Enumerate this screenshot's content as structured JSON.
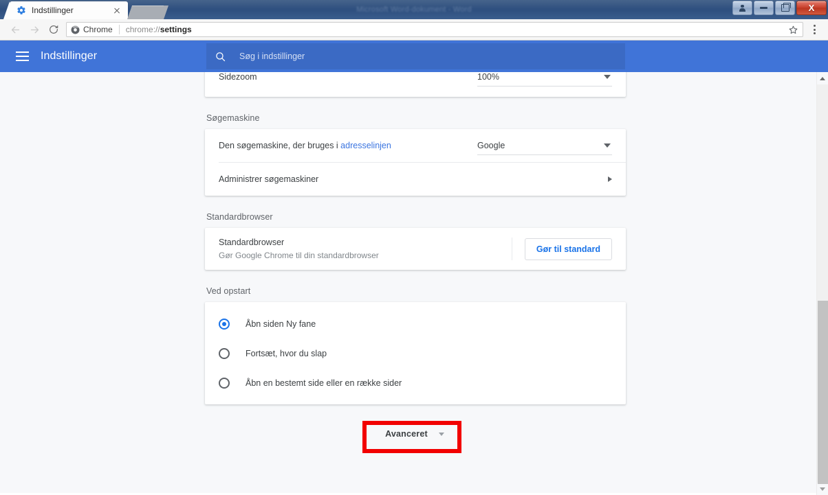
{
  "window": {
    "background_title": "Microsoft Word-dokument - Word",
    "caption_buttons": [
      {
        "name": "account-button",
        "icon": "user-icon",
        "label": ""
      },
      {
        "name": "minimize-button",
        "icon": "minimize-icon",
        "label": ""
      },
      {
        "name": "restore-button",
        "icon": "restore-icon",
        "label": ""
      },
      {
        "name": "close-button",
        "icon": "close-icon",
        "label": "X"
      }
    ]
  },
  "tabs": [
    {
      "title": "Indstillinger",
      "favicon": "gear-icon",
      "active": true
    }
  ],
  "toolbar": {
    "back_icon": "arrow-left-icon",
    "forward_icon": "arrow-right-icon",
    "reload_icon": "reload-icon",
    "security_chip_icon": "chrome-logo-icon",
    "security_chip_label": "Chrome",
    "url_prefix": "chrome://",
    "url_bold": "settings",
    "bookmark_icon": "star-icon",
    "menu_icon": "three-dots-vertical-icon"
  },
  "settings_header": {
    "menu_icon": "hamburger-icon",
    "title": "Indstillinger",
    "search": {
      "icon": "search-icon",
      "value": "",
      "placeholder": "Søg i indstillinger"
    },
    "accent_color": "#4074d8",
    "search_field_color": "#3b6ac4"
  },
  "main": {
    "zoom_row": {
      "label": "Sidezoom",
      "value": "100%",
      "caret_icon": "chevron-down-icon"
    },
    "search_engine_section": {
      "label": "Søgemaskine",
      "default_row": {
        "label_prefix": "Den søgemaskine, der bruges i ",
        "label_link": "adresselinjen",
        "value": "Google",
        "caret_icon": "chevron-down-icon"
      },
      "manage_row": {
        "label": "Administrer søgemaskiner",
        "arrow_icon": "chevron-right-icon"
      }
    },
    "default_browser_section": {
      "label": "Standardbrowser",
      "title": "Standardbrowser",
      "description": "Gør Google Chrome til din standardbrowser",
      "button_label": "Gør til standard",
      "button_color": "#1a73e8"
    },
    "startup_section": {
      "label": "Ved opstart",
      "options": [
        {
          "label": "Åbn siden Ny fane",
          "selected": true
        },
        {
          "label": "Fortsæt, hvor du slap",
          "selected": false
        },
        {
          "label": "Åbn en bestemt side eller en række sider",
          "selected": false
        }
      ],
      "selected_color": "#1a73e8"
    },
    "advanced_button": {
      "label": "Avanceret",
      "caret_icon": "chevron-down-icon",
      "highlight_color": "#f20000"
    }
  },
  "scrollbar": {
    "up_arrow_icon": "triangle-up-icon",
    "down_arrow_icon": "triangle-down-icon",
    "thumb_color": "#c2c2c2"
  }
}
